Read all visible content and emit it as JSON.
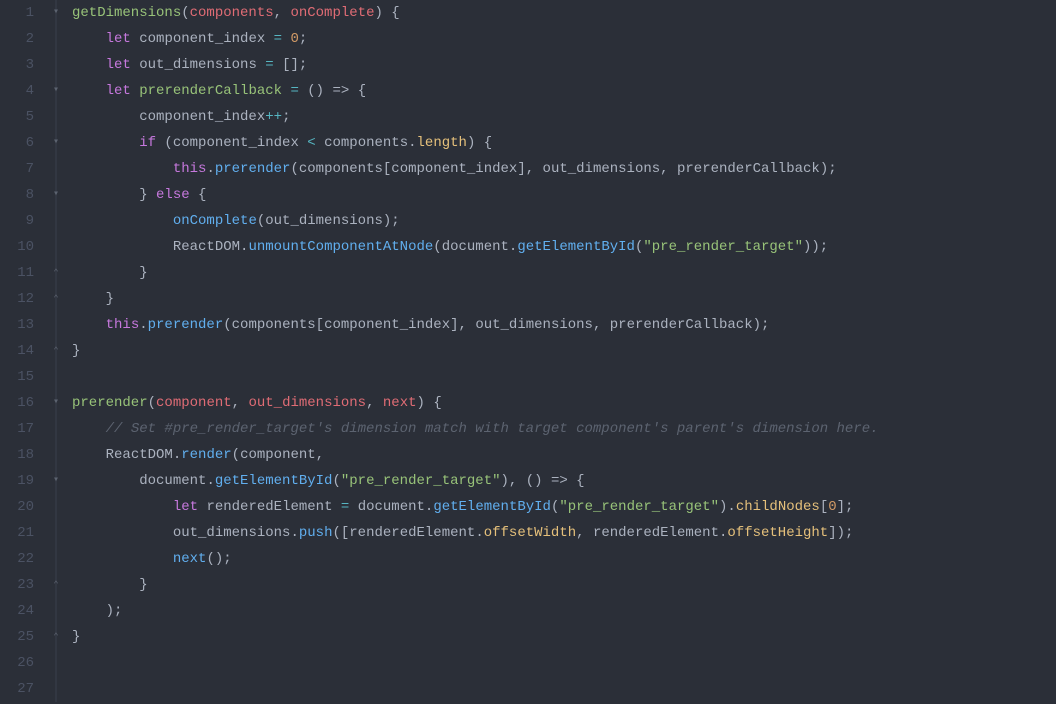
{
  "editor": {
    "lineCount": 27,
    "foldMarks": {
      "1": "open",
      "4": "open",
      "6": "open",
      "7": "bar",
      "8": "close-open",
      "11": "close",
      "12": "close",
      "14": "close",
      "16": "open",
      "19": "open",
      "23": "close",
      "25": "close"
    },
    "tokens": {
      "1": [
        [
          "fn",
          "getDimensions"
        ],
        [
          "punc",
          "("
        ],
        [
          "param",
          "components"
        ],
        [
          "punc",
          ", "
        ],
        [
          "param",
          "onComplete"
        ],
        [
          "punc",
          ") {"
        ]
      ],
      "2": [
        [
          "punc",
          "    "
        ],
        [
          "kw",
          "let"
        ],
        [
          "punc",
          " "
        ],
        [
          "id",
          "component_index"
        ],
        [
          "punc",
          " "
        ],
        [
          "op",
          "="
        ],
        [
          "punc",
          " "
        ],
        [
          "num",
          "0"
        ],
        [
          "punc",
          ";"
        ]
      ],
      "3": [
        [
          "punc",
          "    "
        ],
        [
          "kw",
          "let"
        ],
        [
          "punc",
          " "
        ],
        [
          "id",
          "out_dimensions"
        ],
        [
          "punc",
          " "
        ],
        [
          "op",
          "="
        ],
        [
          "punc",
          " [];"
        ]
      ],
      "4": [
        [
          "punc",
          "    "
        ],
        [
          "kw",
          "let"
        ],
        [
          "punc",
          " "
        ],
        [
          "fn",
          "prerenderCallback"
        ],
        [
          "punc",
          " "
        ],
        [
          "op",
          "="
        ],
        [
          "punc",
          " () "
        ],
        [
          "arrow",
          "=>"
        ],
        [
          "punc",
          " {"
        ]
      ],
      "5": [
        [
          "punc",
          "        "
        ],
        [
          "id",
          "component_index"
        ],
        [
          "op",
          "++"
        ],
        [
          "punc",
          ";"
        ]
      ],
      "6": [
        [
          "punc",
          "        "
        ],
        [
          "kw",
          "if"
        ],
        [
          "punc",
          " ("
        ],
        [
          "id",
          "component_index"
        ],
        [
          "punc",
          " "
        ],
        [
          "op",
          "<"
        ],
        [
          "punc",
          " "
        ],
        [
          "id",
          "components"
        ],
        [
          "punc",
          "."
        ],
        [
          "prop",
          "length"
        ],
        [
          "punc",
          ") {"
        ]
      ],
      "7": [
        [
          "punc",
          "            "
        ],
        [
          "kw",
          "this"
        ],
        [
          "punc",
          "."
        ],
        [
          "call",
          "prerender"
        ],
        [
          "punc",
          "("
        ],
        [
          "id",
          "components"
        ],
        [
          "punc",
          "["
        ],
        [
          "id",
          "component_index"
        ],
        [
          "punc",
          "], "
        ],
        [
          "id",
          "out_dimensions"
        ],
        [
          "punc",
          ", "
        ],
        [
          "id",
          "prerenderCallback"
        ],
        [
          "punc",
          ");"
        ]
      ],
      "8": [
        [
          "punc",
          "        } "
        ],
        [
          "kw",
          "else"
        ],
        [
          "punc",
          " {"
        ]
      ],
      "9": [
        [
          "punc",
          "            "
        ],
        [
          "call",
          "onComplete"
        ],
        [
          "punc",
          "("
        ],
        [
          "id",
          "out_dimensions"
        ],
        [
          "punc",
          ");"
        ]
      ],
      "10": [
        [
          "punc",
          "            "
        ],
        [
          "id",
          "ReactDOM"
        ],
        [
          "punc",
          "."
        ],
        [
          "call",
          "unmountComponentAtNode"
        ],
        [
          "punc",
          "("
        ],
        [
          "id",
          "document"
        ],
        [
          "punc",
          "."
        ],
        [
          "call",
          "getElementById"
        ],
        [
          "punc",
          "("
        ],
        [
          "str",
          "\"pre_render_target\""
        ],
        [
          "punc",
          "));"
        ]
      ],
      "11": [
        [
          "punc",
          "        }"
        ]
      ],
      "12": [
        [
          "punc",
          "    }"
        ]
      ],
      "13": [
        [
          "punc",
          "    "
        ],
        [
          "kw",
          "this"
        ],
        [
          "punc",
          "."
        ],
        [
          "call",
          "prerender"
        ],
        [
          "punc",
          "("
        ],
        [
          "id",
          "components"
        ],
        [
          "punc",
          "["
        ],
        [
          "id",
          "component_index"
        ],
        [
          "punc",
          "], "
        ],
        [
          "id",
          "out_dimensions"
        ],
        [
          "punc",
          ", "
        ],
        [
          "id",
          "prerenderCallback"
        ],
        [
          "punc",
          ");"
        ]
      ],
      "14": [
        [
          "punc",
          "}"
        ]
      ],
      "15": [],
      "16": [
        [
          "fn",
          "prerender"
        ],
        [
          "punc",
          "("
        ],
        [
          "param",
          "component"
        ],
        [
          "punc",
          ", "
        ],
        [
          "param",
          "out_dimensions"
        ],
        [
          "punc",
          ", "
        ],
        [
          "param",
          "next"
        ],
        [
          "punc",
          ") {"
        ]
      ],
      "17": [
        [
          "punc",
          "    "
        ],
        [
          "cmt",
          "// Set #pre_render_target's dimension match with target component's parent's dimension here."
        ]
      ],
      "18": [
        [
          "punc",
          "    "
        ],
        [
          "id",
          "ReactDOM"
        ],
        [
          "punc",
          "."
        ],
        [
          "call",
          "render"
        ],
        [
          "punc",
          "("
        ],
        [
          "id",
          "component"
        ],
        [
          "punc",
          ","
        ]
      ],
      "19": [
        [
          "punc",
          "        "
        ],
        [
          "id",
          "document"
        ],
        [
          "punc",
          "."
        ],
        [
          "call",
          "getElementById"
        ],
        [
          "punc",
          "("
        ],
        [
          "str",
          "\"pre_render_target\""
        ],
        [
          "punc",
          "), () "
        ],
        [
          "arrow",
          "=>"
        ],
        [
          "punc",
          " {"
        ]
      ],
      "20": [
        [
          "punc",
          "            "
        ],
        [
          "kw",
          "let"
        ],
        [
          "punc",
          " "
        ],
        [
          "id",
          "renderedElement"
        ],
        [
          "punc",
          " "
        ],
        [
          "op",
          "="
        ],
        [
          "punc",
          " "
        ],
        [
          "id",
          "document"
        ],
        [
          "punc",
          "."
        ],
        [
          "call",
          "getElementById"
        ],
        [
          "punc",
          "("
        ],
        [
          "str",
          "\"pre_render_target\""
        ],
        [
          "punc",
          ")."
        ],
        [
          "prop",
          "childNodes"
        ],
        [
          "punc",
          "["
        ],
        [
          "num",
          "0"
        ],
        [
          "punc",
          "];"
        ]
      ],
      "21": [
        [
          "punc",
          "            "
        ],
        [
          "id",
          "out_dimensions"
        ],
        [
          "punc",
          "."
        ],
        [
          "call",
          "push"
        ],
        [
          "punc",
          "(["
        ],
        [
          "id",
          "renderedElement"
        ],
        [
          "punc",
          "."
        ],
        [
          "prop",
          "offsetWidth"
        ],
        [
          "punc",
          ", "
        ],
        [
          "id",
          "renderedElement"
        ],
        [
          "punc",
          "."
        ],
        [
          "prop",
          "offsetHeight"
        ],
        [
          "punc",
          "]);"
        ]
      ],
      "22": [
        [
          "punc",
          "            "
        ],
        [
          "call",
          "next"
        ],
        [
          "punc",
          "();"
        ]
      ],
      "23": [
        [
          "punc",
          "        }"
        ]
      ],
      "24": [
        [
          "punc",
          "    );"
        ]
      ],
      "25": [
        [
          "punc",
          "}"
        ]
      ],
      "26": [],
      "27": []
    }
  }
}
